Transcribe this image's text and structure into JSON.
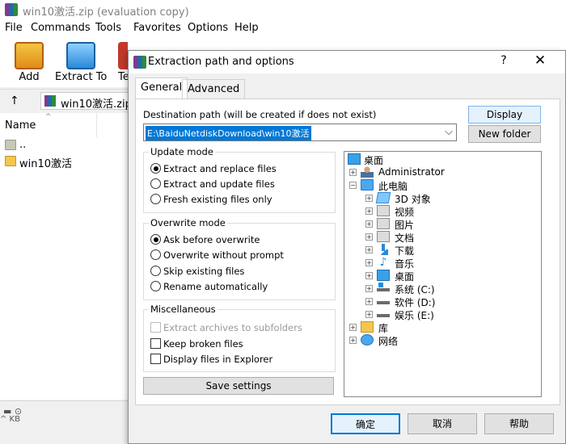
{
  "main": {
    "title": "win10激活.zip (evaluation copy)",
    "menu": [
      "File",
      "Commands",
      "Tools",
      "Favorites",
      "Options",
      "Help"
    ],
    "toolbar": {
      "add": "Add",
      "extract_to": "Extract To",
      "test_partial": "Te"
    },
    "path": "win10激活.zip",
    "column_name": "Name",
    "files": [
      {
        "name": "..",
        "icon": "parent-folder-icon"
      },
      {
        "name": "win10激活",
        "icon": "folder-icon"
      }
    ],
    "status_text": "^ KB"
  },
  "dialog": {
    "title": "Extraction path and options",
    "help_glyph": "?",
    "close_glyph": "✕",
    "tabs": [
      "General",
      "Advanced"
    ],
    "dest_label": "Destination path (will be created if does not exist)",
    "dest_value": "E:\\BaiduNetdiskDownload\\win10激活",
    "display_btn": "Display",
    "newfolder_btn": "New folder",
    "update_mode": {
      "title": "Update mode",
      "options": [
        "Extract and replace files",
        "Extract and update files",
        "Fresh existing files only"
      ],
      "selected": 0
    },
    "overwrite_mode": {
      "title": "Overwrite mode",
      "options": [
        "Ask before overwrite",
        "Overwrite without prompt",
        "Skip existing files",
        "Rename automatically"
      ],
      "selected": 0
    },
    "misc": {
      "title": "Miscellaneous",
      "options": [
        "Extract archives to subfolders",
        "Keep broken files",
        "Display files in Explorer"
      ]
    },
    "save_settings": "Save settings",
    "tree": [
      {
        "label": "桌面",
        "icon": "desktop-icon"
      },
      {
        "label": "Administrator",
        "icon": "user-icon"
      },
      {
        "label": "此电脑",
        "icon": "computer-icon"
      },
      {
        "label": "3D 对象",
        "icon": "3d-objects-icon"
      },
      {
        "label": "视频",
        "icon": "videos-icon"
      },
      {
        "label": "图片",
        "icon": "pictures-icon"
      },
      {
        "label": "文档",
        "icon": "documents-icon"
      },
      {
        "label": "下载",
        "icon": "downloads-icon"
      },
      {
        "label": "音乐",
        "icon": "music-icon"
      },
      {
        "label": "桌面",
        "icon": "desktop-icon"
      },
      {
        "label": "系统 (C:)",
        "icon": "system-drive-icon"
      },
      {
        "label": "软件 (D:)",
        "icon": "drive-icon"
      },
      {
        "label": "娱乐 (E:)",
        "icon": "drive-icon"
      },
      {
        "label": "库",
        "icon": "libraries-icon"
      },
      {
        "label": "网络",
        "icon": "network-icon"
      }
    ],
    "ok": "确定",
    "cancel": "取消",
    "help": "帮助"
  }
}
